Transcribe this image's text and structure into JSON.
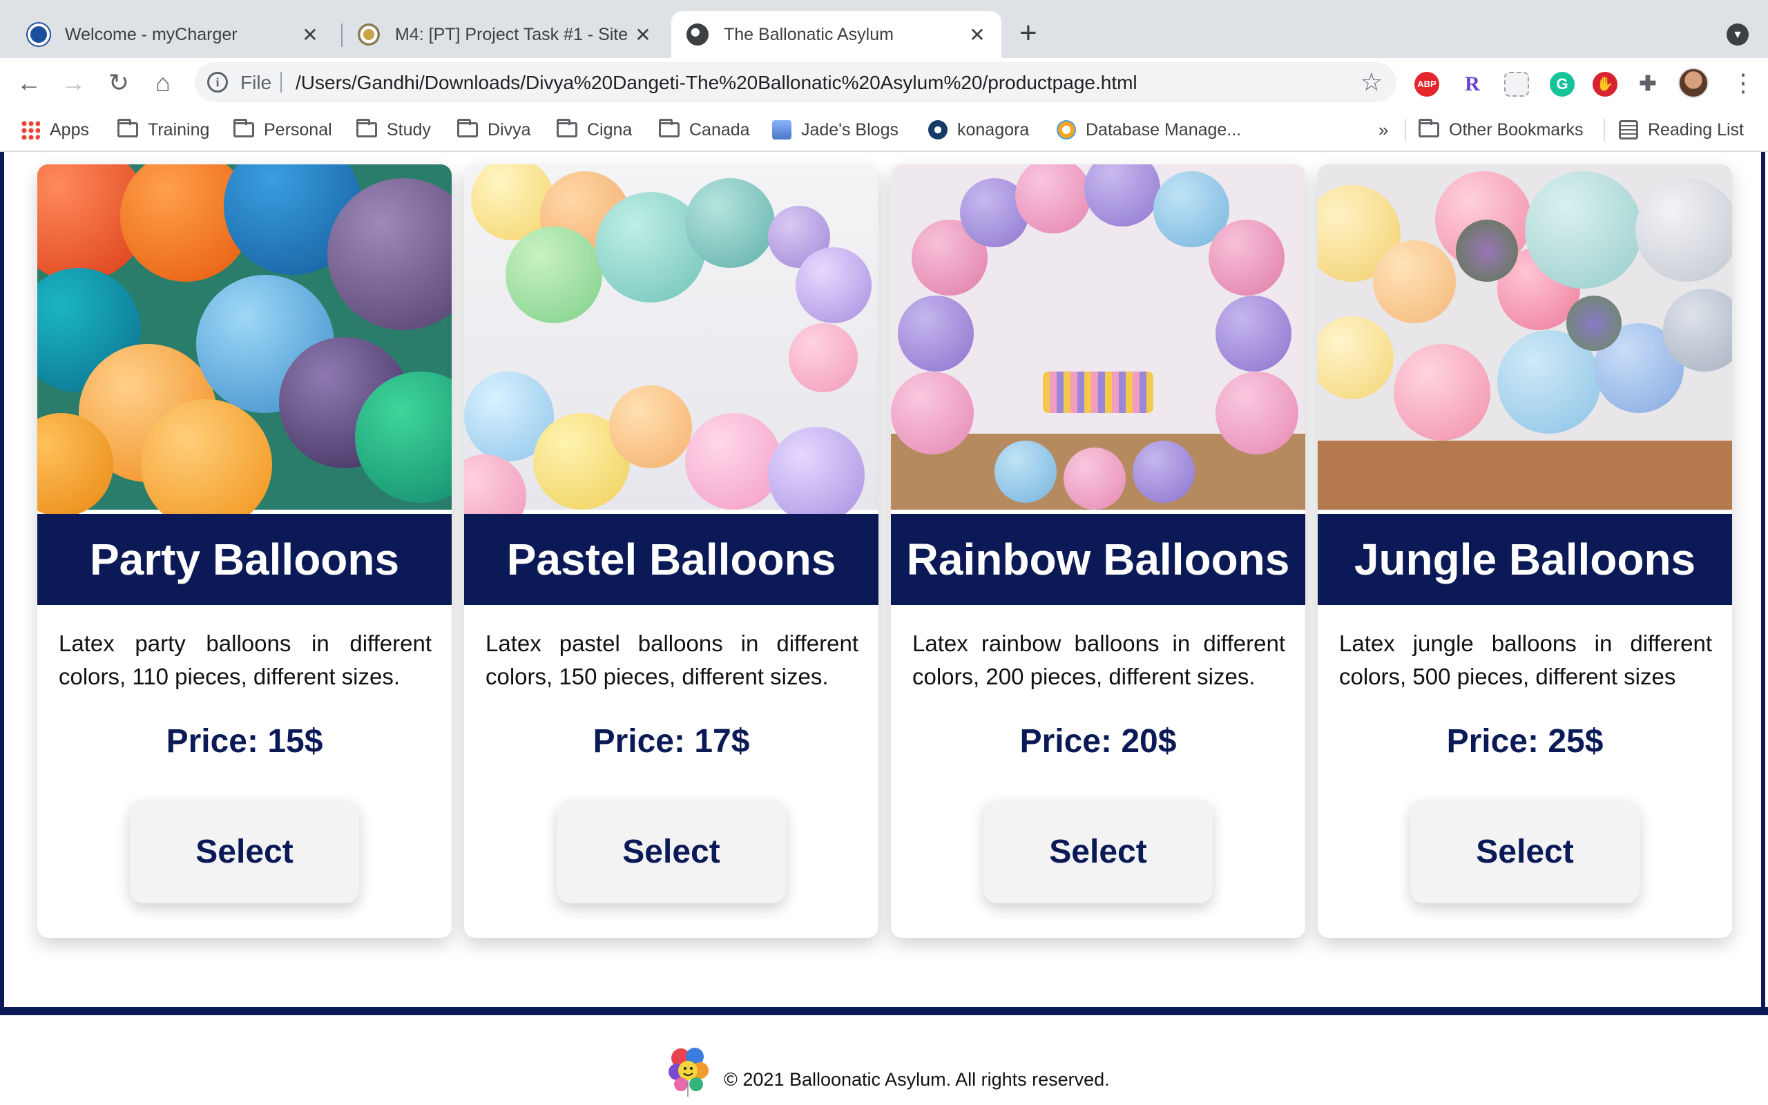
{
  "browser": {
    "tabs": [
      {
        "title": "Welcome - myCharger",
        "active": false
      },
      {
        "title": "M4: [PT] Project Task #1 - Site",
        "active": false
      },
      {
        "title": "The Ballonatic Asylum",
        "active": true
      }
    ],
    "address": {
      "scheme": "File",
      "url": "/Users/Gandhi/Downloads/Divya%20Dangeti-The%20Ballonatic%20Asylum%20/productpage.html"
    },
    "extensions": [
      "ABP",
      "R"
    ],
    "bookmarks": [
      {
        "label": "Apps",
        "icon": "apps-grid-icon"
      },
      {
        "label": "Training",
        "icon": "folder-icon"
      },
      {
        "label": "Personal",
        "icon": "folder-icon"
      },
      {
        "label": "Study",
        "icon": "folder-icon"
      },
      {
        "label": "Divya",
        "icon": "folder-icon"
      },
      {
        "label": "Cigna",
        "icon": "folder-icon"
      },
      {
        "label": "Canada",
        "icon": "folder-icon"
      },
      {
        "label": "Jade's Blogs",
        "icon": "blog-icon"
      },
      {
        "label": "konagora",
        "icon": "konagora-icon"
      },
      {
        "label": "Database Manage...",
        "icon": "database-icon"
      }
    ],
    "overflow": "»",
    "other_bookmarks": "Other Bookmarks",
    "reading_list": "Reading List"
  },
  "products": [
    {
      "name": "Party Balloons",
      "description": "Latex party balloons in different colors, 110 pieces, different sizes.",
      "price": "Price: 15$",
      "button": "Select"
    },
    {
      "name": "Pastel Balloons",
      "description": "Latex pastel balloons in different colors, 150 pieces, different sizes.",
      "price": "Price: 17$",
      "button": "Select"
    },
    {
      "name": "Rainbow Balloons",
      "description": "Latex rainbow balloons in different colors, 200 pieces, different sizes.",
      "price": "Price: 20$",
      "button": "Select"
    },
    {
      "name": "Jungle Balloons",
      "description": "Latex jungle balloons in different colors, 500 pieces, different sizes",
      "price": "Price: 25$",
      "button": "Select"
    }
  ],
  "footer": {
    "copyright": "© 2021 Balloonatic Asylum. All rights reserved."
  },
  "colors": {
    "brand_navy": "#0b1a57",
    "button_bg": "#f3f3f4"
  }
}
